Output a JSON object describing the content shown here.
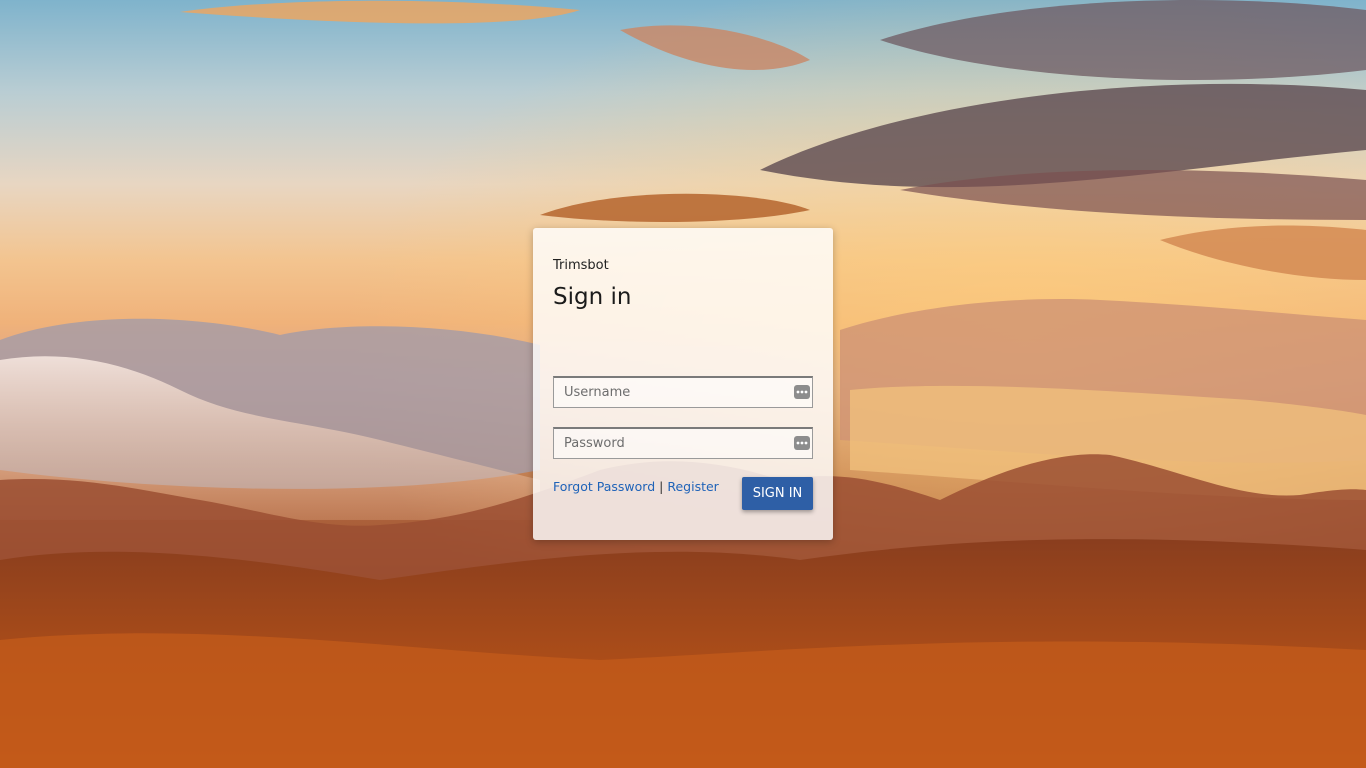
{
  "login": {
    "app_name": "Trimsbot",
    "title": "Sign in",
    "username_placeholder": "Username",
    "password_placeholder": "Password",
    "forgot_password_link": "Forgot Password",
    "link_separator": "|",
    "register_link": "Register",
    "signin_button": "SIGN IN"
  },
  "colors": {
    "button": "#2e5fa6",
    "link": "#1f63b8",
    "card_background": "rgba(255,255,255,0.82)"
  },
  "icons": {
    "field_icon": "key-icon"
  }
}
